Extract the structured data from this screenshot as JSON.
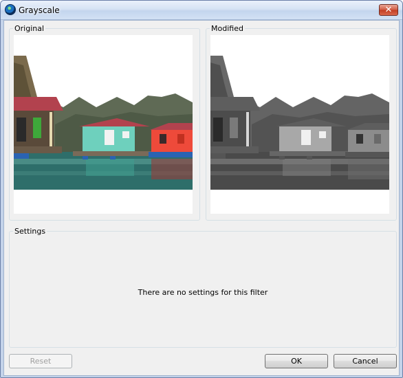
{
  "window": {
    "title": "Grayscale",
    "close_glyph": "✕"
  },
  "panels": {
    "original_label": "Original",
    "modified_label": "Modified"
  },
  "settings": {
    "label": "Settings",
    "message": "There are no settings for this filter"
  },
  "buttons": {
    "reset": "Reset",
    "ok": "OK",
    "cancel": "Cancel"
  },
  "icons": {
    "app": "filter-app-icon",
    "close": "close-icon"
  },
  "colors": {
    "house_green_roof": "#b2424e",
    "house_green_wall": "#6ed0bd",
    "house_red_wall": "#ee4a3a",
    "water": "#2e6e6a"
  }
}
